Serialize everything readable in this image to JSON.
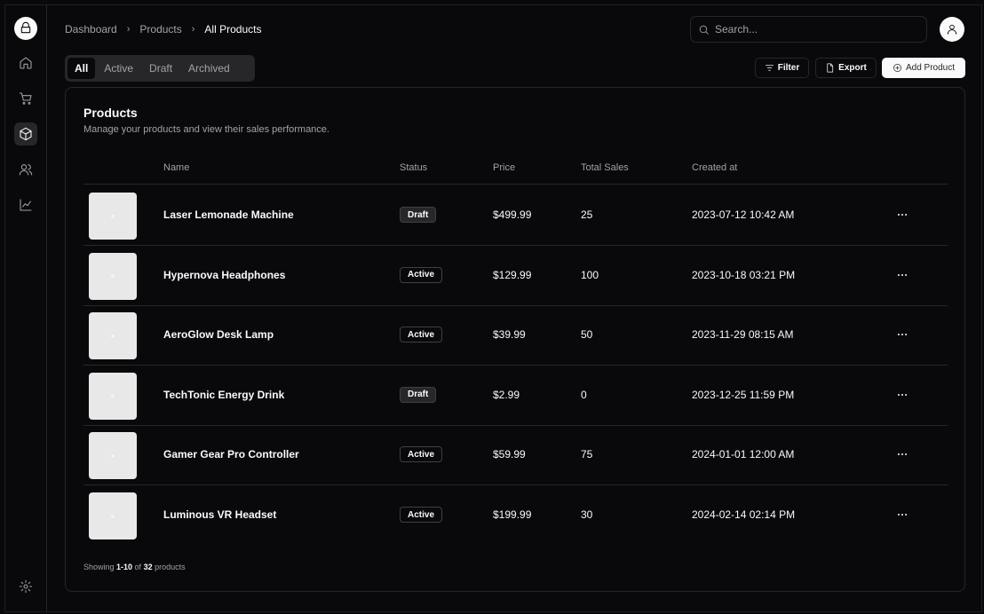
{
  "breadcrumb": [
    "Dashboard",
    "Products",
    "All Products"
  ],
  "search": {
    "placeholder": "Search..."
  },
  "tabs": [
    "All",
    "Active",
    "Draft",
    "Archived"
  ],
  "toolbar": {
    "filter_label": "Filter",
    "export_label": "Export",
    "add_label": "Add Product"
  },
  "card": {
    "title": "Products",
    "description": "Manage your products and view their sales performance."
  },
  "columns": {
    "name": "Name",
    "status": "Status",
    "price": "Price",
    "total_sales": "Total Sales",
    "created_at": "Created at"
  },
  "products": [
    {
      "name": "Laser Lemonade Machine",
      "status": "Draft",
      "price": "$499.99",
      "sales": "25",
      "created": "2023-07-12 10:42 AM"
    },
    {
      "name": "Hypernova Headphones",
      "status": "Active",
      "price": "$129.99",
      "sales": "100",
      "created": "2023-10-18 03:21 PM"
    },
    {
      "name": "AeroGlow Desk Lamp",
      "status": "Active",
      "price": "$39.99",
      "sales": "50",
      "created": "2023-11-29 08:15 AM"
    },
    {
      "name": "TechTonic Energy Drink",
      "status": "Draft",
      "price": "$2.99",
      "sales": "0",
      "created": "2023-12-25 11:59 PM"
    },
    {
      "name": "Gamer Gear Pro Controller",
      "status": "Active",
      "price": "$59.99",
      "sales": "75",
      "created": "2024-01-01 12:00 AM"
    },
    {
      "name": "Luminous VR Headset",
      "status": "Active",
      "price": "$199.99",
      "sales": "30",
      "created": "2024-02-14 02:14 PM"
    }
  ],
  "footer": {
    "prefix": "Showing ",
    "range": "1-10",
    "middle": " of ",
    "total": "32",
    "suffix": " products"
  },
  "colors": {
    "background": "#09090b",
    "border": "#27272a",
    "muted": "#a1a1aa",
    "foreground": "#fafafa"
  },
  "icons": {
    "logo": "store-icon",
    "nav": [
      "home-icon",
      "cart-icon",
      "package-icon",
      "users-icon",
      "line-chart-icon"
    ],
    "settings": "settings-icon"
  }
}
